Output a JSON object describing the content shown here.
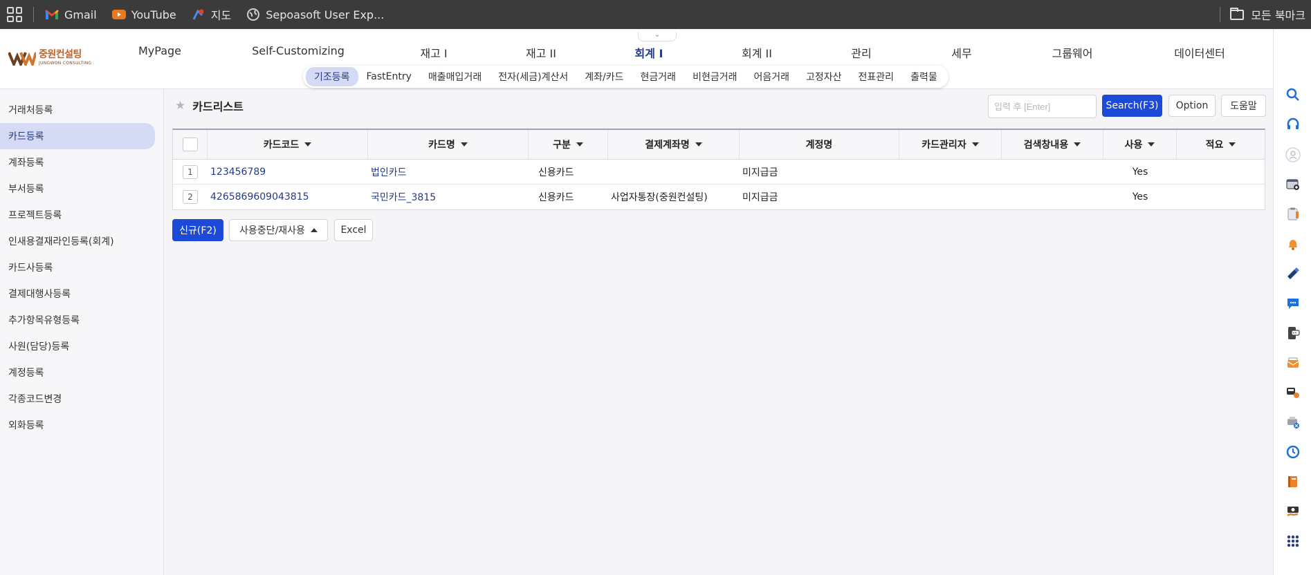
{
  "bookmarks": {
    "items": [
      {
        "label": "Gmail",
        "icon": "gmail-icon"
      },
      {
        "label": "YouTube",
        "icon": "youtube-icon"
      },
      {
        "label": "지도",
        "icon": "maps-icon"
      },
      {
        "label": "Sepoasoft User Exp...",
        "icon": "globe-icon"
      }
    ],
    "all_bookmarks": "모든 북마크"
  },
  "logo": {
    "name_kr": "중원컨설팅",
    "name_en": "JUNGWON CONSULTING"
  },
  "main_menu": [
    {
      "label": "MyPage"
    },
    {
      "label": "Self-Customizing"
    },
    {
      "label": "재고 I"
    },
    {
      "label": "재고 II"
    },
    {
      "label": "회계 I",
      "active": true
    },
    {
      "label": "회계 II"
    },
    {
      "label": "관리"
    },
    {
      "label": "세무"
    },
    {
      "label": "그룹웨어"
    },
    {
      "label": "데이터센터"
    }
  ],
  "sub_menu": [
    {
      "label": "기조등록",
      "active": true
    },
    {
      "label": "FastEntry"
    },
    {
      "label": "매출매입거래"
    },
    {
      "label": "전자(세금)계산서"
    },
    {
      "label": "계좌/카드"
    },
    {
      "label": "현금거래"
    },
    {
      "label": "비현금거래"
    },
    {
      "label": "어음거래"
    },
    {
      "label": "고정자산"
    },
    {
      "label": "전표관리"
    },
    {
      "label": "출력물"
    }
  ],
  "sidebar": {
    "items": [
      {
        "label": "거래처등록"
      },
      {
        "label": "카드등록",
        "active": true
      },
      {
        "label": "계좌등록"
      },
      {
        "label": "부서등록"
      },
      {
        "label": "프로젝트등록"
      },
      {
        "label": "인새용결재라인등록(회계)"
      },
      {
        "label": "카드사등록"
      },
      {
        "label": "결제대행사등록"
      },
      {
        "label": "추가항목유형등록"
      },
      {
        "label": "사원(담당)등록"
      },
      {
        "label": "계정등록"
      },
      {
        "label": "각종코드변경"
      },
      {
        "label": "외화등록"
      }
    ]
  },
  "page": {
    "title": "카드리스트",
    "search_placeholder": "입력 후 [Enter]",
    "search_button": "Search(F3)",
    "option_button": "Option",
    "help_button": "도움말"
  },
  "table": {
    "columns": [
      "카드코드",
      "카드명",
      "구분",
      "결제계좌명",
      "계정명",
      "카드관리자",
      "검색창내용",
      "사용",
      "적요"
    ],
    "rows": [
      {
        "num": "1",
        "code": "123456789",
        "name": "법인카드",
        "kind": "신용카드",
        "account": "",
        "gl": "미지급금",
        "manager": "",
        "search": "",
        "use": "Yes",
        "memo": ""
      },
      {
        "num": "2",
        "code": "4265869609043815",
        "name": "국민카드_3815",
        "kind": "신용카드",
        "account": "사업자통장(중원컨설팅)",
        "gl": "미지급금",
        "manager": "",
        "search": "",
        "use": "Yes",
        "memo": ""
      }
    ]
  },
  "actions": {
    "new_button": "신규(F2)",
    "toggle_button": "사용중단/재사용",
    "excel_button": "Excel"
  },
  "colors": {
    "primary": "#1d49d8",
    "active_menu_bg": "#d5daf5",
    "active_text": "#233a88",
    "bookmark_bar": "#3b3b3b"
  }
}
